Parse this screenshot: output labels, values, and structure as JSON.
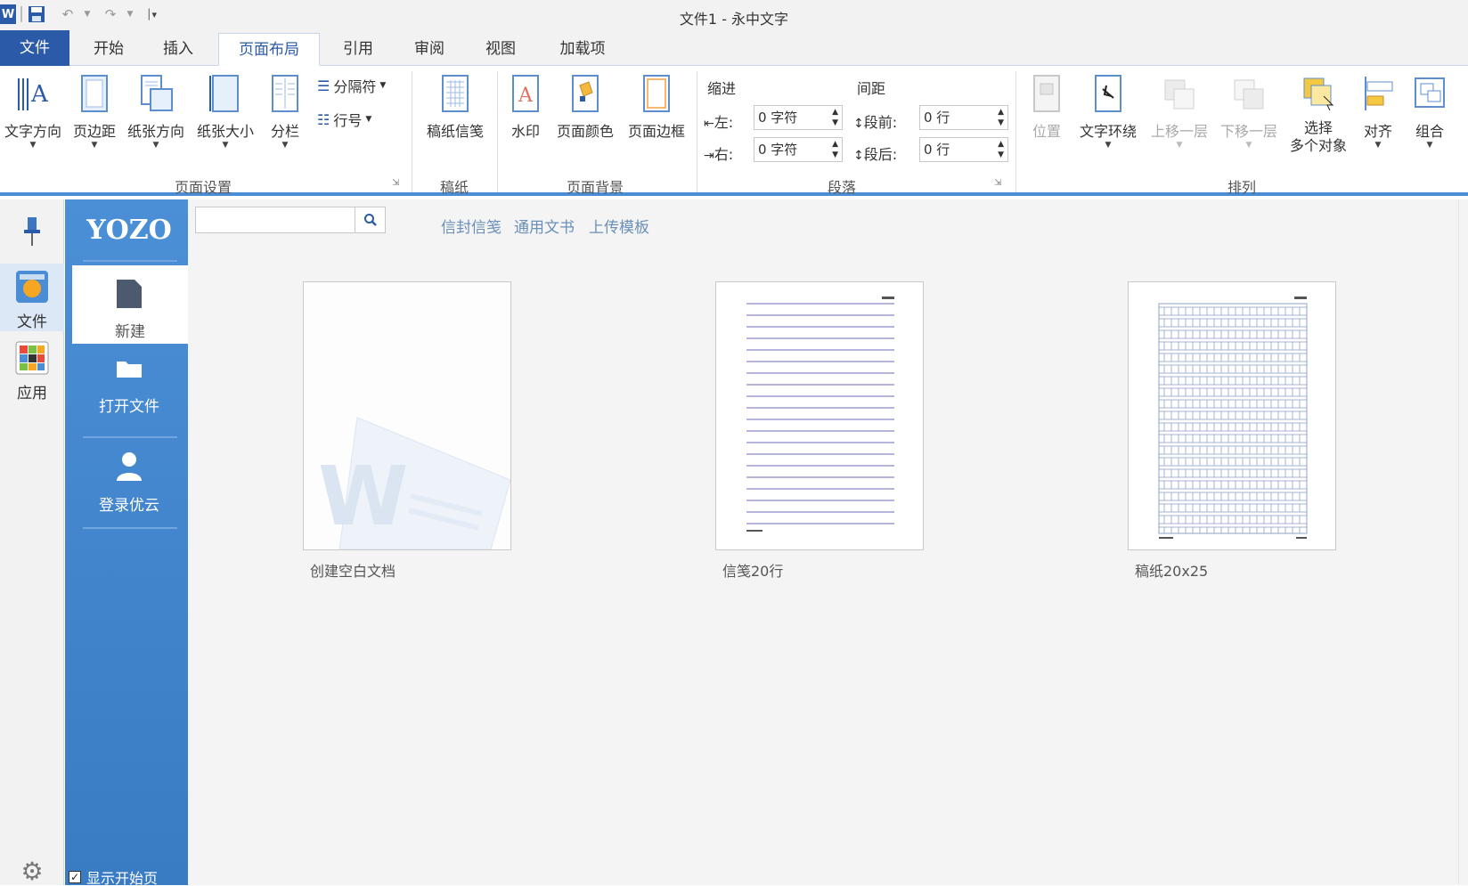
{
  "window": {
    "title": "文件1 - 永中文字"
  },
  "quick_access": {
    "app_icon": "W"
  },
  "tabs": [
    {
      "label": "文件"
    },
    {
      "label": "开始"
    },
    {
      "label": "插入"
    },
    {
      "label": "页面布局"
    },
    {
      "label": "引用"
    },
    {
      "label": "审阅"
    },
    {
      "label": "视图"
    },
    {
      "label": "加载项"
    }
  ],
  "ribbon": {
    "page_setup": {
      "label": "页面设置",
      "text_direction": "文字方向",
      "margins": "页边距",
      "orientation": "纸张方向",
      "size": "纸张大小",
      "columns": "分栏",
      "breaks": "分隔符",
      "line_numbers": "行号"
    },
    "draft": {
      "label": "稿纸",
      "draft_paper": "稿纸信笺"
    },
    "background": {
      "label": "页面背景",
      "watermark": "水印",
      "page_color": "页面颜色",
      "page_border": "页面边框"
    },
    "paragraph": {
      "label": "段落",
      "indent_title": "缩进",
      "spacing_title": "间距",
      "left_label": "左:",
      "right_label": "右:",
      "before_label": "段前:",
      "after_label": "段后:",
      "left_value": "0 字符",
      "right_value": "0 字符",
      "before_value": "0 行",
      "after_value": "0 行"
    },
    "arrange": {
      "label": "排列",
      "position": "位置",
      "wrap_text": "文字环绕",
      "bring_forward": "上移一层",
      "send_backward": "下移一层",
      "select_line1": "选择",
      "select_line2": "多个对象",
      "align": "对齐",
      "group": "组合"
    }
  },
  "leftbar": {
    "file": "文件",
    "apps": "应用"
  },
  "sidepanel": {
    "logo": "YOZO",
    "new": "新建",
    "open": "打开文件",
    "login": "登录优云",
    "show_start": "显示开始页"
  },
  "main": {
    "search_placeholder": "",
    "links": [
      "信封信笺",
      "通用文书",
      "上传模板"
    ],
    "templates": [
      {
        "label": "创建空白文档"
      },
      {
        "label": "信笺20行"
      },
      {
        "label": "稿纸20x25"
      }
    ]
  }
}
